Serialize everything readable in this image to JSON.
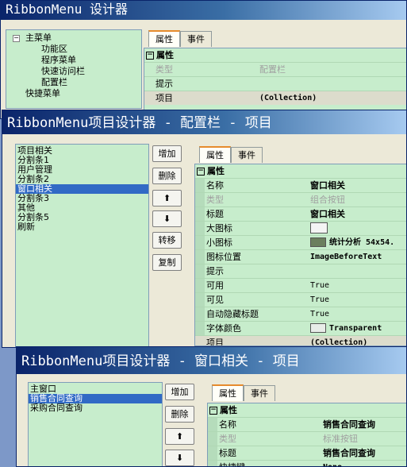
{
  "win1": {
    "title": "RibbonMenu 设计器",
    "tree": {
      "root": "主菜单",
      "children": [
        "功能区",
        "程序菜单",
        "快速访问栏",
        "配置栏"
      ],
      "second_root": "快捷菜单"
    },
    "tabs": [
      "属性",
      "事件"
    ],
    "category": "属性",
    "props": [
      {
        "name": "类型",
        "value": "配置栏"
      },
      {
        "name": "提示",
        "value": ""
      },
      {
        "name": "项目",
        "value": "(Collection)"
      }
    ]
  },
  "win2": {
    "title": "RibbonMenu项目设计器 - 配置栏 - 项目",
    "items": [
      "项目相关",
      "分割条1",
      "用户管理",
      "分割条2",
      "窗口相关",
      "分割条3",
      "其他",
      "分割条5",
      "刷新"
    ],
    "selected_index": 4,
    "buttons": {
      "add": "增加",
      "delete": "删除",
      "up": "⬆",
      "down": "⬇",
      "move": "转移",
      "copy": "复制"
    },
    "tabs": [
      "属性",
      "事件"
    ],
    "category": "属性",
    "props": [
      {
        "name": "名称",
        "value": "窗口相关"
      },
      {
        "name": "类型",
        "value": "组合按钮"
      },
      {
        "name": "标题",
        "value": "窗口相关"
      },
      {
        "name": "大图标",
        "value": ""
      },
      {
        "name": "小图标",
        "value": "统计分析 54x54."
      },
      {
        "name": "图标位置",
        "value": "ImageBeforeText"
      },
      {
        "name": "提示",
        "value": ""
      },
      {
        "name": "可用",
        "value": "True"
      },
      {
        "name": "可见",
        "value": "True"
      },
      {
        "name": "自动隐藏标题",
        "value": "True"
      },
      {
        "name": "字体颜色",
        "value": "Transparent"
      },
      {
        "name": "项目",
        "value": "(Collection)"
      }
    ]
  },
  "win3": {
    "title": "RibbonMenu项目设计器 - 窗口相关 - 项目",
    "items": [
      "主窗口",
      "销售合同查询",
      "采购合同查询"
    ],
    "selected_index": 1,
    "buttons": {
      "add": "增加",
      "delete": "删除",
      "up": "⬆",
      "down": "⬇"
    },
    "tabs": [
      "属性",
      "事件"
    ],
    "category": "属性",
    "props": [
      {
        "name": "名称",
        "value": "销售合同查询"
      },
      {
        "name": "类型",
        "value": "标准按钮"
      },
      {
        "name": "标题",
        "value": "销售合同查询"
      },
      {
        "name": "快捷键",
        "value": "None"
      }
    ]
  }
}
